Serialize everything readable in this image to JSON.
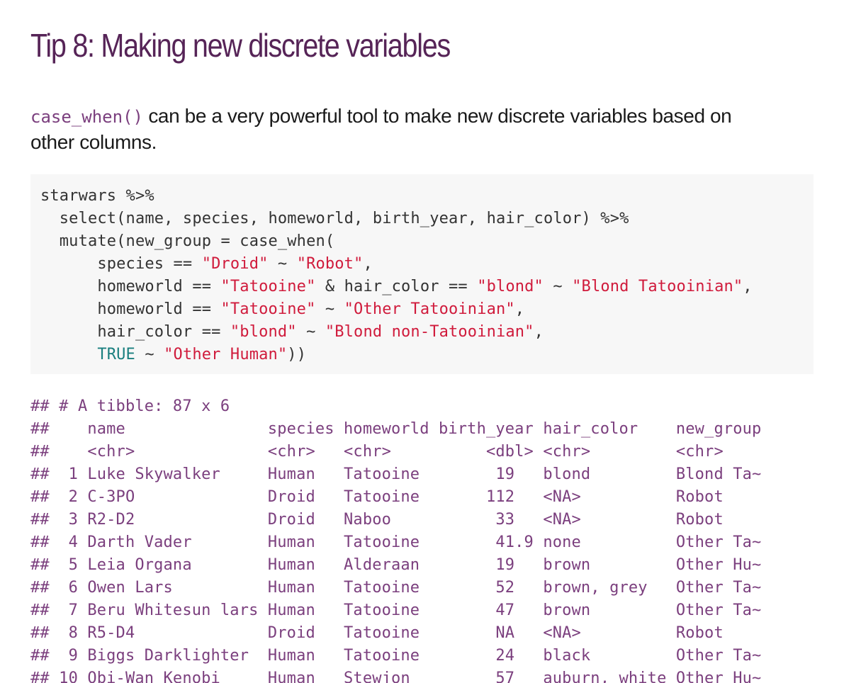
{
  "title": "Tip 8: Making new discrete variables",
  "intro": {
    "code": "case_when()",
    "text_line1": " can be a very powerful tool to make new discrete variables based on",
    "text_line2": "other columns."
  },
  "code_block": {
    "lines": [
      [
        {
          "t": "starwars %>%",
          "c": ""
        }
      ],
      [
        {
          "t": "  select(name, species, homeworld, birth_year, hair_color) %>%",
          "c": ""
        }
      ],
      [
        {
          "t": "  mutate(new_group = case_when(",
          "c": ""
        }
      ],
      [
        {
          "t": "      species == ",
          "c": ""
        },
        {
          "t": "\"Droid\"",
          "c": "str"
        },
        {
          "t": " ~ ",
          "c": ""
        },
        {
          "t": "\"Robot\"",
          "c": "str"
        },
        {
          "t": ",",
          "c": ""
        }
      ],
      [
        {
          "t": "      homeworld == ",
          "c": ""
        },
        {
          "t": "\"Tatooine\"",
          "c": "str"
        },
        {
          "t": " & hair_color == ",
          "c": ""
        },
        {
          "t": "\"blond\"",
          "c": "str"
        },
        {
          "t": " ~ ",
          "c": ""
        },
        {
          "t": "\"Blond Tatooinian\"",
          "c": "str"
        },
        {
          "t": ",",
          "c": ""
        }
      ],
      [
        {
          "t": "      homeworld == ",
          "c": ""
        },
        {
          "t": "\"Tatooine\"",
          "c": "str"
        },
        {
          "t": " ~ ",
          "c": ""
        },
        {
          "t": "\"Other Tatooinian\"",
          "c": "str"
        },
        {
          "t": ",",
          "c": ""
        }
      ],
      [
        {
          "t": "      hair_color == ",
          "c": ""
        },
        {
          "t": "\"blond\"",
          "c": "str"
        },
        {
          "t": " ~ ",
          "c": ""
        },
        {
          "t": "\"Blond non-Tatooinian\"",
          "c": "str"
        },
        {
          "t": ",",
          "c": ""
        }
      ],
      [
        {
          "t": "      ",
          "c": ""
        },
        {
          "t": "TRUE",
          "c": "kw"
        },
        {
          "t": " ~ ",
          "c": ""
        },
        {
          "t": "\"Other Human\"",
          "c": "str"
        },
        {
          "t": "))",
          "c": ""
        }
      ]
    ]
  },
  "output": {
    "lines": [
      "## # A tibble: 87 x 6",
      "##    name               species homeworld birth_year hair_color    new_group",
      "##    <chr>              <chr>   <chr>          <dbl> <chr>         <chr>",
      "##  1 Luke Skywalker     Human   Tatooine        19   blond         Blond Ta~",
      "##  2 C-3PO              Droid   Tatooine       112   <NA>          Robot",
      "##  3 R2-D2              Droid   Naboo           33   <NA>          Robot",
      "##  4 Darth Vader        Human   Tatooine        41.9 none          Other Ta~",
      "##  5 Leia Organa        Human   Alderaan        19   brown         Other Hu~",
      "##  6 Owen Lars          Human   Tatooine        52   brown, grey   Other Ta~",
      "##  7 Beru Whitesun lars Human   Tatooine        47   brown         Other Ta~",
      "##  8 R5-D4              Droid   Tatooine        NA   <NA>          Robot",
      "##  9 Biggs Darklighter  Human   Tatooine        24   black         Other Ta~",
      "## 10 Obi-Wan Kenobi     Human   Stewjon         57   auburn, white Other Hu~"
    ]
  }
}
